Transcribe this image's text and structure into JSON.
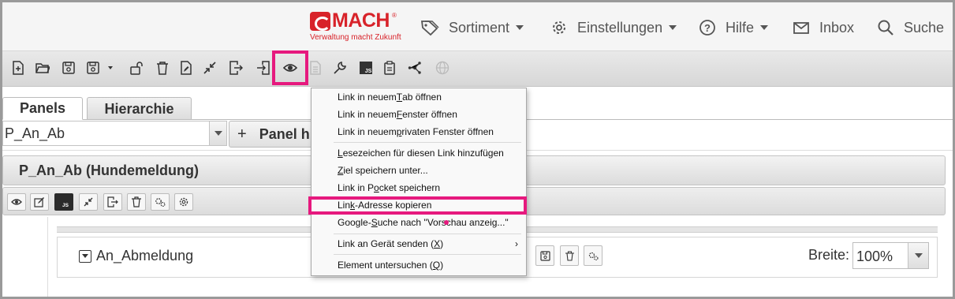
{
  "brand": {
    "logo_text": "MACH",
    "logo_reg": "®",
    "tagline": "Verwaltung macht Zukunft",
    "logo_color": "#d8232a"
  },
  "topnav": {
    "items": [
      {
        "label": "Sortiment",
        "icon": "tag-icon",
        "has_dropdown": true
      },
      {
        "label": "Einstellungen",
        "icon": "gear-icon",
        "has_dropdown": true
      },
      {
        "label": "Hilfe",
        "icon": "question-circle-icon",
        "has_dropdown": true
      },
      {
        "label": "Inbox",
        "icon": "envelope-icon",
        "has_dropdown": false
      },
      {
        "label": "Suche",
        "icon": "search-icon",
        "has_dropdown": false
      }
    ]
  },
  "toolbar": {
    "icons": [
      "new-file-icon",
      "open-folder-icon",
      "save-icon",
      "save-as-icon",
      "unlock-icon",
      "delete-icon",
      "edit-file-icon",
      "collapse-icon",
      "export-icon",
      "import-icon",
      "preview-eye-icon",
      "document-disabled-icon",
      "wrench-icon",
      "js-icon",
      "clipboard-icon",
      "graph-icon",
      "globe-disabled-icon"
    ],
    "highlight_color": "#e6197e"
  },
  "tabs": [
    {
      "label": "Panels",
      "active": true
    },
    {
      "label": "Hierarchie",
      "active": false
    }
  ],
  "panel_selector": {
    "value": "P_An_Ab",
    "add_label": "Panel h"
  },
  "panel": {
    "title": "P_An_Ab (Hundemeldung)",
    "tool_icons": [
      "eye-icon",
      "edit-icon",
      "js-icon",
      "collapse-icon",
      "export-icon",
      "delete-icon",
      "settings-multi-icon",
      "gear-icon"
    ]
  },
  "element": {
    "title": "An_Abmeldung",
    "width_label": "Breite:",
    "width_value": "100%",
    "tool_icons": [
      "save-icon",
      "delete-icon",
      "settings-multi-icon"
    ]
  },
  "context_menu": {
    "items": [
      {
        "pre": "Link in neuem ",
        "u": "T",
        "post": "ab öffnen"
      },
      {
        "pre": "Link in neuem ",
        "u": "F",
        "post": "enster öffnen"
      },
      {
        "pre": "Link in neuem ",
        "u": "p",
        "post": "rivaten Fenster öffnen"
      },
      {
        "pre": "",
        "u": "L",
        "post": "esezeichen für diesen Link hinzufügen"
      },
      {
        "pre": "",
        "u": "Z",
        "post": "iel speichern unter..."
      },
      {
        "pre": "Link in P",
        "u": "o",
        "post": "cket speichern"
      },
      {
        "pre": "Lin",
        "u": "k",
        "post": "-Adresse kopieren"
      },
      {
        "pre": "Google-",
        "u": "S",
        "post": "uche nach \"Vorschau anzeig...\""
      },
      {
        "pre": "Link an Gerät senden (",
        "u": "X",
        "post": ")"
      },
      {
        "pre": "Element untersuchen (",
        "u": "Q",
        "post": ")"
      }
    ],
    "submenu_arrow": "›"
  }
}
